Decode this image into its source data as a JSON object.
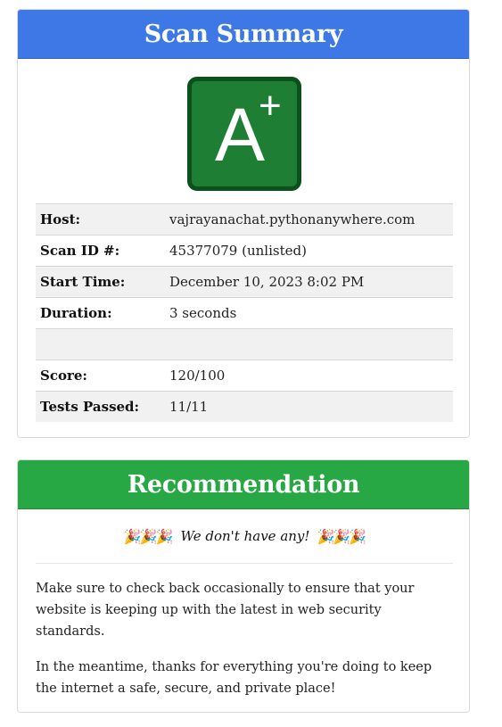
{
  "summary": {
    "title": "Scan Summary",
    "grade": {
      "letter": "A",
      "modifier": "+"
    },
    "rows": [
      {
        "label": "Host:",
        "value": "vajrayanachat.pythonanywhere.com"
      },
      {
        "label": "Scan ID #:",
        "value": "45377079 (unlisted)"
      },
      {
        "label": "Start Time:",
        "value": "December 10, 2023 8:02 PM"
      },
      {
        "label": "Duration:",
        "value": "3 seconds"
      },
      {
        "label": "",
        "value": ""
      },
      {
        "label": "Score:",
        "value": "120/100"
      },
      {
        "label": "Tests Passed:",
        "value": "11/11"
      }
    ]
  },
  "recommendation": {
    "title": "Recommendation",
    "confetti_left": "🎉🎉🎉",
    "headline": "We don't have any!",
    "confetti_right": "🎉🎉🎉",
    "paragraphs": [
      "Make sure to check back occasionally to ensure that your website is keeping up with the latest in web security standards.",
      "In the meantime, thanks for everything you're doing to keep the internet a safe, secure, and private place!"
    ]
  },
  "colors": {
    "summary_header": "#3d78e6",
    "recommendation_header": "#28a745",
    "grade_fill": "#1e7e34",
    "grade_border": "#0d4f1d"
  }
}
